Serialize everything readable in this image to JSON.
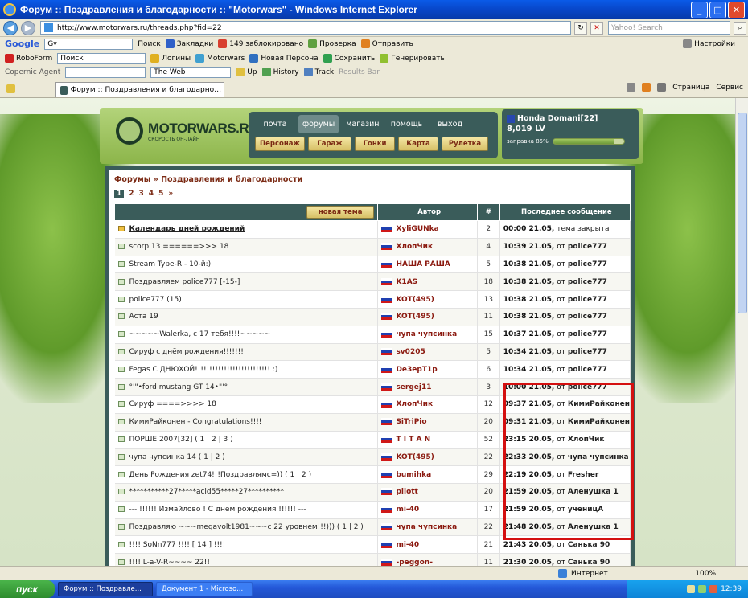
{
  "window": {
    "title": "Форум :: Поздравления и благодарности :: \"Motorwars\" - Windows Internet Explorer"
  },
  "address": {
    "url": "http://www.motorwars.ru/threads.php?fid=22",
    "search_placeholder": "Yahoo! Search"
  },
  "toolbar1": {
    "google": "Google",
    "search_btn": "Поиск",
    "bookmarks": "Закладки",
    "blocked": "149 заблокировано",
    "check": "Проверка",
    "send": "Отправить",
    "settings": "Настройки"
  },
  "toolbar2": {
    "roboform": "RoboForm",
    "search_field": "Поиск",
    "logins": "Логины",
    "motorwars": "Motorwars",
    "new_persona": "Новая Персона",
    "save": "Сохранить",
    "generate": "Генерировать"
  },
  "toolbar3": {
    "copernic": "Copernic Agent",
    "theweb": "The Web",
    "up": "Up",
    "history": "History",
    "track": "Track",
    "results": "Results Bar"
  },
  "tabbar": {
    "tab_title": "Форум :: Поздравления и благодарности :: \"Motor...",
    "page_menu": "Страница",
    "service_menu": "Сервис"
  },
  "site": {
    "logo": "MOTORWARS.RU",
    "tagline": "СКОРОСТЬ ОН-ЛАЙН",
    "menu_top": [
      "почта",
      "форумы",
      "магазин",
      "помощь",
      "выход"
    ],
    "menu_bottom": [
      "Персонаж",
      "Гараж",
      "Гонки",
      "Карта",
      "Рулетка"
    ],
    "user": {
      "name": "Honda Domani[22]",
      "money": "8,019 LV",
      "fuel_label": "заправка 85%",
      "fuel": 0.85
    }
  },
  "forum": {
    "crumb_root": "Форумы",
    "crumb_sep": "»",
    "crumb_section": "Поздравления и благодарности",
    "pages": [
      "1",
      "2",
      "3",
      "4",
      "5",
      "»"
    ],
    "new_topic": "новая тема",
    "headers": {
      "author": "Автор",
      "count": "#",
      "last": "Последнее сообщение"
    },
    "rows": [
      {
        "title": "Календарь дней рождений",
        "author": "XyliGUNka",
        "count": "2",
        "date": "00:00 21.05,",
        "by": "тема закрыта"
      },
      {
        "title": "scorp 13 ======>>> 18",
        "author": "ХлопЧик",
        "count": "4",
        "date": "10:39 21.05,",
        "by": "police777"
      },
      {
        "title": "Stream Type-R - 10-й:)",
        "author": "НАША РАША",
        "count": "5",
        "date": "10:38 21.05,",
        "by": "police777"
      },
      {
        "title": "Поздравляем police777 [-15-]",
        "author": "K1AS",
        "count": "18",
        "date": "10:38 21.05,",
        "by": "police777"
      },
      {
        "title": "police777 (15)",
        "author": "KOT(495)",
        "count": "13",
        "date": "10:38 21.05,",
        "by": "police777"
      },
      {
        "title": "Аста 19",
        "author": "KOT(495)",
        "count": "11",
        "date": "10:38 21.05,",
        "by": "police777"
      },
      {
        "title": "~~~~~Walerka, с 17 тебя!!!!~~~~~",
        "author": "чупа чупсинка",
        "count": "15",
        "date": "10:37 21.05,",
        "by": "police777"
      },
      {
        "title": "Сируф с днём рождения!!!!!!!",
        "author": "sv0205",
        "count": "5",
        "date": "10:34 21.05,",
        "by": "police777"
      },
      {
        "title": "Fegas С ДНЮХОЙ!!!!!!!!!!!!!!!!!!!!!!!!!! :)",
        "author": "De3epT1p",
        "count": "6",
        "date": "10:34 21.05,",
        "by": "police777"
      },
      {
        "title": "°'\"•ford mustang GT 14•\"'°",
        "author": "sergej11",
        "count": "3",
        "date": "10:00 21.05,",
        "by": "police777"
      },
      {
        "title": "Сируф ====>>>> 18",
        "author": "ХлопЧик",
        "count": "12",
        "date": "09:37 21.05,",
        "by": "КимиРайконен"
      },
      {
        "title": "КимиРайконен - Congratulations!!!!",
        "author": "SiTriPio",
        "count": "20",
        "date": "09:31 21.05,",
        "by": "КимиРайконен"
      },
      {
        "title": "ПОРШЕ 2007[32] ( 1 | 2 | 3 )",
        "author": "T I T A N",
        "count": "52",
        "date": "23:15 20.05,",
        "by": "ХлопЧик"
      },
      {
        "title": "чупа чупсинка 14 ( 1 | 2 )",
        "author": "KOT(495)",
        "count": "22",
        "date": "22:33 20.05,",
        "by": "чупа чупсинка"
      },
      {
        "title": "День Рождения zet74!!!Поздравлямс=)) ( 1 | 2 )",
        "author": "bumihka",
        "count": "29",
        "date": "22:19 20.05,",
        "by": "Fresher"
      },
      {
        "title": "***********27*****acid55*****27**********",
        "author": "pilott",
        "count": "20",
        "date": "21:59 20.05,",
        "by": "Аленушка 1"
      },
      {
        "title": "--- !!!!!! Измайлово ! С днём рождения !!!!!! ---",
        "author": "mi-40",
        "count": "17",
        "date": "21:59 20.05,",
        "by": "ученицА"
      },
      {
        "title": "Поздравляю ~~~megavolt1981~~~с 22 уровнем!!!))) ( 1 | 2 )",
        "author": "чупа чупсинка",
        "count": "22",
        "date": "21:48 20.05,",
        "by": "Аленушка 1"
      },
      {
        "title": "!!!! SoNn777 !!!! [ 14 ] !!!!",
        "author": "mi-40",
        "count": "21",
        "date": "21:43 20.05,",
        "by": "Санька 90"
      },
      {
        "title": "!!!! L-a-V-R~~~~ 22!!",
        "author": "-peggon-",
        "count": "11",
        "date": "21:30 20.05,",
        "by": "Санька 90"
      }
    ]
  },
  "status": {
    "zone": "Интернет",
    "zoom": "100%"
  },
  "taskbar": {
    "start": "пуск",
    "task1": "Форум :: Поздравле...",
    "task2": "Документ 1 - Microso...",
    "clock": "12:39"
  },
  "colors": {
    "accent_dark": "#3a5c5a",
    "link_red": "#7b2a14",
    "highlight": "#d41010"
  }
}
